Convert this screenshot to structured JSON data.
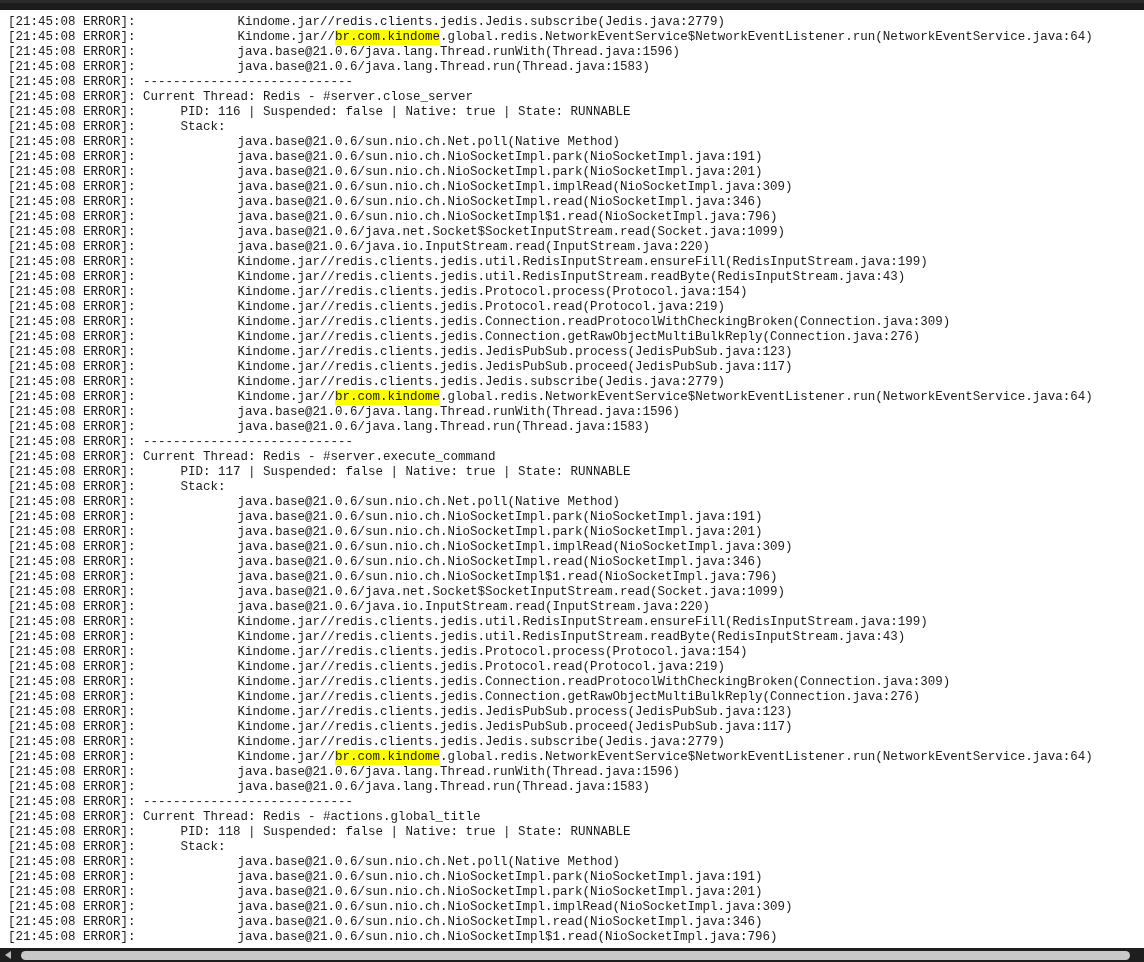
{
  "lines": [
    {
      "prefix": "[21:45:08 ERROR]:",
      "kind": "frame",
      "parts": [
        {
          "text": "Kindome.jar//redis.clients.jedis.Jedis.subscribe(Jedis.java:2779)",
          "highlighted": false
        }
      ]
    },
    {
      "prefix": "[21:45:08 ERROR]:",
      "kind": "frame",
      "parts": [
        {
          "text": "Kindome.jar//",
          "highlighted": false
        },
        {
          "text": "br.com.kindome",
          "highlighted": true
        },
        {
          "text": ".global.redis.NetworkEventService$NetworkEventListener.run(NetworkEventService.java:64)",
          "highlighted": false
        }
      ]
    },
    {
      "prefix": "[21:45:08 ERROR]:",
      "kind": "frame",
      "parts": [
        {
          "text": "java.base@21.0.6/java.lang.Thread.runWith(Thread.java:1596)",
          "highlighted": false
        }
      ]
    },
    {
      "prefix": "[21:45:08 ERROR]:",
      "kind": "frame",
      "parts": [
        {
          "text": "java.base@21.0.6/java.lang.Thread.run(Thread.java:1583)",
          "highlighted": false
        }
      ]
    },
    {
      "prefix": "[21:45:08 ERROR]:",
      "kind": "separator",
      "parts": [
        {
          "text": "----------------------------",
          "highlighted": false
        }
      ]
    },
    {
      "prefix": "[21:45:08 ERROR]:",
      "kind": "thread",
      "parts": [
        {
          "text": "Current Thread: Redis - #server.close_server",
          "highlighted": false
        }
      ]
    },
    {
      "prefix": "[21:45:08 ERROR]:",
      "kind": "info",
      "parts": [
        {
          "text": "PID: 116 | Suspended: false | Native: true | State: RUNNABLE",
          "highlighted": false
        }
      ]
    },
    {
      "prefix": "[21:45:08 ERROR]:",
      "kind": "info",
      "parts": [
        {
          "text": "Stack:",
          "highlighted": false
        }
      ]
    },
    {
      "prefix": "[21:45:08 ERROR]:",
      "kind": "frame",
      "parts": [
        {
          "text": "java.base@21.0.6/sun.nio.ch.Net.poll(Native Method)",
          "highlighted": false
        }
      ]
    },
    {
      "prefix": "[21:45:08 ERROR]:",
      "kind": "frame",
      "parts": [
        {
          "text": "java.base@21.0.6/sun.nio.ch.NioSocketImpl.park(NioSocketImpl.java:191)",
          "highlighted": false
        }
      ]
    },
    {
      "prefix": "[21:45:08 ERROR]:",
      "kind": "frame",
      "parts": [
        {
          "text": "java.base@21.0.6/sun.nio.ch.NioSocketImpl.park(NioSocketImpl.java:201)",
          "highlighted": false
        }
      ]
    },
    {
      "prefix": "[21:45:08 ERROR]:",
      "kind": "frame",
      "parts": [
        {
          "text": "java.base@21.0.6/sun.nio.ch.NioSocketImpl.implRead(NioSocketImpl.java:309)",
          "highlighted": false
        }
      ]
    },
    {
      "prefix": "[21:45:08 ERROR]:",
      "kind": "frame",
      "parts": [
        {
          "text": "java.base@21.0.6/sun.nio.ch.NioSocketImpl.read(NioSocketImpl.java:346)",
          "highlighted": false
        }
      ]
    },
    {
      "prefix": "[21:45:08 ERROR]:",
      "kind": "frame",
      "parts": [
        {
          "text": "java.base@21.0.6/sun.nio.ch.NioSocketImpl$1.read(NioSocketImpl.java:796)",
          "highlighted": false
        }
      ]
    },
    {
      "prefix": "[21:45:08 ERROR]:",
      "kind": "frame",
      "parts": [
        {
          "text": "java.base@21.0.6/java.net.Socket$SocketInputStream.read(Socket.java:1099)",
          "highlighted": false
        }
      ]
    },
    {
      "prefix": "[21:45:08 ERROR]:",
      "kind": "frame",
      "parts": [
        {
          "text": "java.base@21.0.6/java.io.InputStream.read(InputStream.java:220)",
          "highlighted": false
        }
      ]
    },
    {
      "prefix": "[21:45:08 ERROR]:",
      "kind": "frame",
      "parts": [
        {
          "text": "Kindome.jar//redis.clients.jedis.util.RedisInputStream.ensureFill(RedisInputStream.java:199)",
          "highlighted": false
        }
      ]
    },
    {
      "prefix": "[21:45:08 ERROR]:",
      "kind": "frame",
      "parts": [
        {
          "text": "Kindome.jar//redis.clients.jedis.util.RedisInputStream.readByte(RedisInputStream.java:43)",
          "highlighted": false
        }
      ]
    },
    {
      "prefix": "[21:45:08 ERROR]:",
      "kind": "frame",
      "parts": [
        {
          "text": "Kindome.jar//redis.clients.jedis.Protocol.process(Protocol.java:154)",
          "highlighted": false
        }
      ]
    },
    {
      "prefix": "[21:45:08 ERROR]:",
      "kind": "frame",
      "parts": [
        {
          "text": "Kindome.jar//redis.clients.jedis.Protocol.read(Protocol.java:219)",
          "highlighted": false
        }
      ]
    },
    {
      "prefix": "[21:45:08 ERROR]:",
      "kind": "frame",
      "parts": [
        {
          "text": "Kindome.jar//redis.clients.jedis.Connection.readProtocolWithCheckingBroken(Connection.java:309)",
          "highlighted": false
        }
      ]
    },
    {
      "prefix": "[21:45:08 ERROR]:",
      "kind": "frame",
      "parts": [
        {
          "text": "Kindome.jar//redis.clients.jedis.Connection.getRawObjectMultiBulkReply(Connection.java:276)",
          "highlighted": false
        }
      ]
    },
    {
      "prefix": "[21:45:08 ERROR]:",
      "kind": "frame",
      "parts": [
        {
          "text": "Kindome.jar//redis.clients.jedis.JedisPubSub.process(JedisPubSub.java:123)",
          "highlighted": false
        }
      ]
    },
    {
      "prefix": "[21:45:08 ERROR]:",
      "kind": "frame",
      "parts": [
        {
          "text": "Kindome.jar//redis.clients.jedis.JedisPubSub.proceed(JedisPubSub.java:117)",
          "highlighted": false
        }
      ]
    },
    {
      "prefix": "[21:45:08 ERROR]:",
      "kind": "frame",
      "parts": [
        {
          "text": "Kindome.jar//redis.clients.jedis.Jedis.subscribe(Jedis.java:2779)",
          "highlighted": false
        }
      ]
    },
    {
      "prefix": "[21:45:08 ERROR]:",
      "kind": "frame",
      "parts": [
        {
          "text": "Kindome.jar//",
          "highlighted": false
        },
        {
          "text": "br.com.kindome",
          "highlighted": true
        },
        {
          "text": ".global.redis.NetworkEventService$NetworkEventListener.run(NetworkEventService.java:64)",
          "highlighted": false
        }
      ]
    },
    {
      "prefix": "[21:45:08 ERROR]:",
      "kind": "frame",
      "parts": [
        {
          "text": "java.base@21.0.6/java.lang.Thread.runWith(Thread.java:1596)",
          "highlighted": false
        }
      ]
    },
    {
      "prefix": "[21:45:08 ERROR]:",
      "kind": "frame",
      "parts": [
        {
          "text": "java.base@21.0.6/java.lang.Thread.run(Thread.java:1583)",
          "highlighted": false
        }
      ]
    },
    {
      "prefix": "[21:45:08 ERROR]:",
      "kind": "separator",
      "parts": [
        {
          "text": "----------------------------",
          "highlighted": false
        }
      ]
    },
    {
      "prefix": "[21:45:08 ERROR]:",
      "kind": "thread",
      "parts": [
        {
          "text": "Current Thread: Redis - #server.execute_command",
          "highlighted": false
        }
      ]
    },
    {
      "prefix": "[21:45:08 ERROR]:",
      "kind": "info",
      "parts": [
        {
          "text": "PID: 117 | Suspended: false | Native: true | State: RUNNABLE",
          "highlighted": false
        }
      ]
    },
    {
      "prefix": "[21:45:08 ERROR]:",
      "kind": "info",
      "parts": [
        {
          "text": "Stack:",
          "highlighted": false
        }
      ]
    },
    {
      "prefix": "[21:45:08 ERROR]:",
      "kind": "frame",
      "parts": [
        {
          "text": "java.base@21.0.6/sun.nio.ch.Net.poll(Native Method)",
          "highlighted": false
        }
      ]
    },
    {
      "prefix": "[21:45:08 ERROR]:",
      "kind": "frame",
      "parts": [
        {
          "text": "java.base@21.0.6/sun.nio.ch.NioSocketImpl.park(NioSocketImpl.java:191)",
          "highlighted": false
        }
      ]
    },
    {
      "prefix": "[21:45:08 ERROR]:",
      "kind": "frame",
      "parts": [
        {
          "text": "java.base@21.0.6/sun.nio.ch.NioSocketImpl.park(NioSocketImpl.java:201)",
          "highlighted": false
        }
      ]
    },
    {
      "prefix": "[21:45:08 ERROR]:",
      "kind": "frame",
      "parts": [
        {
          "text": "java.base@21.0.6/sun.nio.ch.NioSocketImpl.implRead(NioSocketImpl.java:309)",
          "highlighted": false
        }
      ]
    },
    {
      "prefix": "[21:45:08 ERROR]:",
      "kind": "frame",
      "parts": [
        {
          "text": "java.base@21.0.6/sun.nio.ch.NioSocketImpl.read(NioSocketImpl.java:346)",
          "highlighted": false
        }
      ]
    },
    {
      "prefix": "[21:45:08 ERROR]:",
      "kind": "frame",
      "parts": [
        {
          "text": "java.base@21.0.6/sun.nio.ch.NioSocketImpl$1.read(NioSocketImpl.java:796)",
          "highlighted": false
        }
      ]
    },
    {
      "prefix": "[21:45:08 ERROR]:",
      "kind": "frame",
      "parts": [
        {
          "text": "java.base@21.0.6/java.net.Socket$SocketInputStream.read(Socket.java:1099)",
          "highlighted": false
        }
      ]
    },
    {
      "prefix": "[21:45:08 ERROR]:",
      "kind": "frame",
      "parts": [
        {
          "text": "java.base@21.0.6/java.io.InputStream.read(InputStream.java:220)",
          "highlighted": false
        }
      ]
    },
    {
      "prefix": "[21:45:08 ERROR]:",
      "kind": "frame",
      "parts": [
        {
          "text": "Kindome.jar//redis.clients.jedis.util.RedisInputStream.ensureFill(RedisInputStream.java:199)",
          "highlighted": false
        }
      ]
    },
    {
      "prefix": "[21:45:08 ERROR]:",
      "kind": "frame",
      "parts": [
        {
          "text": "Kindome.jar//redis.clients.jedis.util.RedisInputStream.readByte(RedisInputStream.java:43)",
          "highlighted": false
        }
      ]
    },
    {
      "prefix": "[21:45:08 ERROR]:",
      "kind": "frame",
      "parts": [
        {
          "text": "Kindome.jar//redis.clients.jedis.Protocol.process(Protocol.java:154)",
          "highlighted": false
        }
      ]
    },
    {
      "prefix": "[21:45:08 ERROR]:",
      "kind": "frame",
      "parts": [
        {
          "text": "Kindome.jar//redis.clients.jedis.Protocol.read(Protocol.java:219)",
          "highlighted": false
        }
      ]
    },
    {
      "prefix": "[21:45:08 ERROR]:",
      "kind": "frame",
      "parts": [
        {
          "text": "Kindome.jar//redis.clients.jedis.Connection.readProtocolWithCheckingBroken(Connection.java:309)",
          "highlighted": false
        }
      ]
    },
    {
      "prefix": "[21:45:08 ERROR]:",
      "kind": "frame",
      "parts": [
        {
          "text": "Kindome.jar//redis.clients.jedis.Connection.getRawObjectMultiBulkReply(Connection.java:276)",
          "highlighted": false
        }
      ]
    },
    {
      "prefix": "[21:45:08 ERROR]:",
      "kind": "frame",
      "parts": [
        {
          "text": "Kindome.jar//redis.clients.jedis.JedisPubSub.process(JedisPubSub.java:123)",
          "highlighted": false
        }
      ]
    },
    {
      "prefix": "[21:45:08 ERROR]:",
      "kind": "frame",
      "parts": [
        {
          "text": "Kindome.jar//redis.clients.jedis.JedisPubSub.proceed(JedisPubSub.java:117)",
          "highlighted": false
        }
      ]
    },
    {
      "prefix": "[21:45:08 ERROR]:",
      "kind": "frame",
      "parts": [
        {
          "text": "Kindome.jar//redis.clients.jedis.Jedis.subscribe(Jedis.java:2779)",
          "highlighted": false
        }
      ]
    },
    {
      "prefix": "[21:45:08 ERROR]:",
      "kind": "frame",
      "parts": [
        {
          "text": "Kindome.jar//",
          "highlighted": false
        },
        {
          "text": "br.com.kindome",
          "highlighted": true
        },
        {
          "text": ".global.redis.NetworkEventService$NetworkEventListener.run(NetworkEventService.java:64)",
          "highlighted": false
        }
      ]
    },
    {
      "prefix": "[21:45:08 ERROR]:",
      "kind": "frame",
      "parts": [
        {
          "text": "java.base@21.0.6/java.lang.Thread.runWith(Thread.java:1596)",
          "highlighted": false
        }
      ]
    },
    {
      "prefix": "[21:45:08 ERROR]:",
      "kind": "frame",
      "parts": [
        {
          "text": "java.base@21.0.6/java.lang.Thread.run(Thread.java:1583)",
          "highlighted": false
        }
      ]
    },
    {
      "prefix": "[21:45:08 ERROR]:",
      "kind": "separator",
      "parts": [
        {
          "text": "----------------------------",
          "highlighted": false
        }
      ]
    },
    {
      "prefix": "[21:45:08 ERROR]:",
      "kind": "thread",
      "parts": [
        {
          "text": "Current Thread: Redis - #actions.global_title",
          "highlighted": false
        }
      ]
    },
    {
      "prefix": "[21:45:08 ERROR]:",
      "kind": "info",
      "parts": [
        {
          "text": "PID: 118 | Suspended: false | Native: true | State: RUNNABLE",
          "highlighted": false
        }
      ]
    },
    {
      "prefix": "[21:45:08 ERROR]:",
      "kind": "info",
      "parts": [
        {
          "text": "Stack:",
          "highlighted": false
        }
      ]
    },
    {
      "prefix": "[21:45:08 ERROR]:",
      "kind": "frame",
      "parts": [
        {
          "text": "java.base@21.0.6/sun.nio.ch.Net.poll(Native Method)",
          "highlighted": false
        }
      ]
    },
    {
      "prefix": "[21:45:08 ERROR]:",
      "kind": "frame",
      "parts": [
        {
          "text": "java.base@21.0.6/sun.nio.ch.NioSocketImpl.park(NioSocketImpl.java:191)",
          "highlighted": false
        }
      ]
    },
    {
      "prefix": "[21:45:08 ERROR]:",
      "kind": "frame",
      "parts": [
        {
          "text": "java.base@21.0.6/sun.nio.ch.NioSocketImpl.park(NioSocketImpl.java:201)",
          "highlighted": false
        }
      ]
    },
    {
      "prefix": "[21:45:08 ERROR]:",
      "kind": "frame",
      "parts": [
        {
          "text": "java.base@21.0.6/sun.nio.ch.NioSocketImpl.implRead(NioSocketImpl.java:309)",
          "highlighted": false
        }
      ]
    },
    {
      "prefix": "[21:45:08 ERROR]:",
      "kind": "frame",
      "parts": [
        {
          "text": "java.base@21.0.6/sun.nio.ch.NioSocketImpl.read(NioSocketImpl.java:346)",
          "highlighted": false
        }
      ]
    },
    {
      "prefix": "[21:45:08 ERROR]:",
      "kind": "frame",
      "parts": [
        {
          "text": "java.base@21.0.6/sun.nio.ch.NioSocketImpl$1.read(NioSocketImpl.java:796)",
          "highlighted": false
        }
      ]
    }
  ]
}
